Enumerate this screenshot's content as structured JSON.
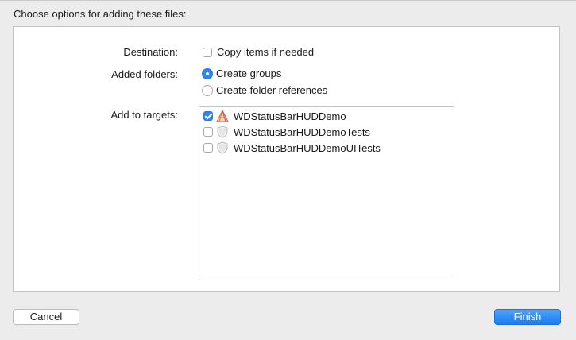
{
  "dialog": {
    "title": "Choose options for adding these files:"
  },
  "options": {
    "destination": {
      "label": "Destination:",
      "checkbox_label": "Copy items if needed",
      "checked": false
    },
    "added_folders": {
      "label": "Added folders:",
      "choices": [
        {
          "label": "Create groups",
          "selected": true
        },
        {
          "label": "Create folder references",
          "selected": false
        }
      ]
    },
    "targets": {
      "label": "Add to targets:",
      "items": [
        {
          "name": "WDStatusBarHUDDemo",
          "checked": true,
          "icon": "app-target-icon"
        },
        {
          "name": "WDStatusBarHUDDemoTests",
          "checked": false,
          "icon": "test-target-icon"
        },
        {
          "name": "WDStatusBarHUDDemoUITests",
          "checked": false,
          "icon": "test-target-icon"
        }
      ]
    }
  },
  "buttons": {
    "cancel_label": "Cancel",
    "finish_label": "Finish"
  },
  "colors": {
    "accent": "#2e86f2",
    "window_background": "#ececec",
    "panel_background": "#ffffff"
  }
}
